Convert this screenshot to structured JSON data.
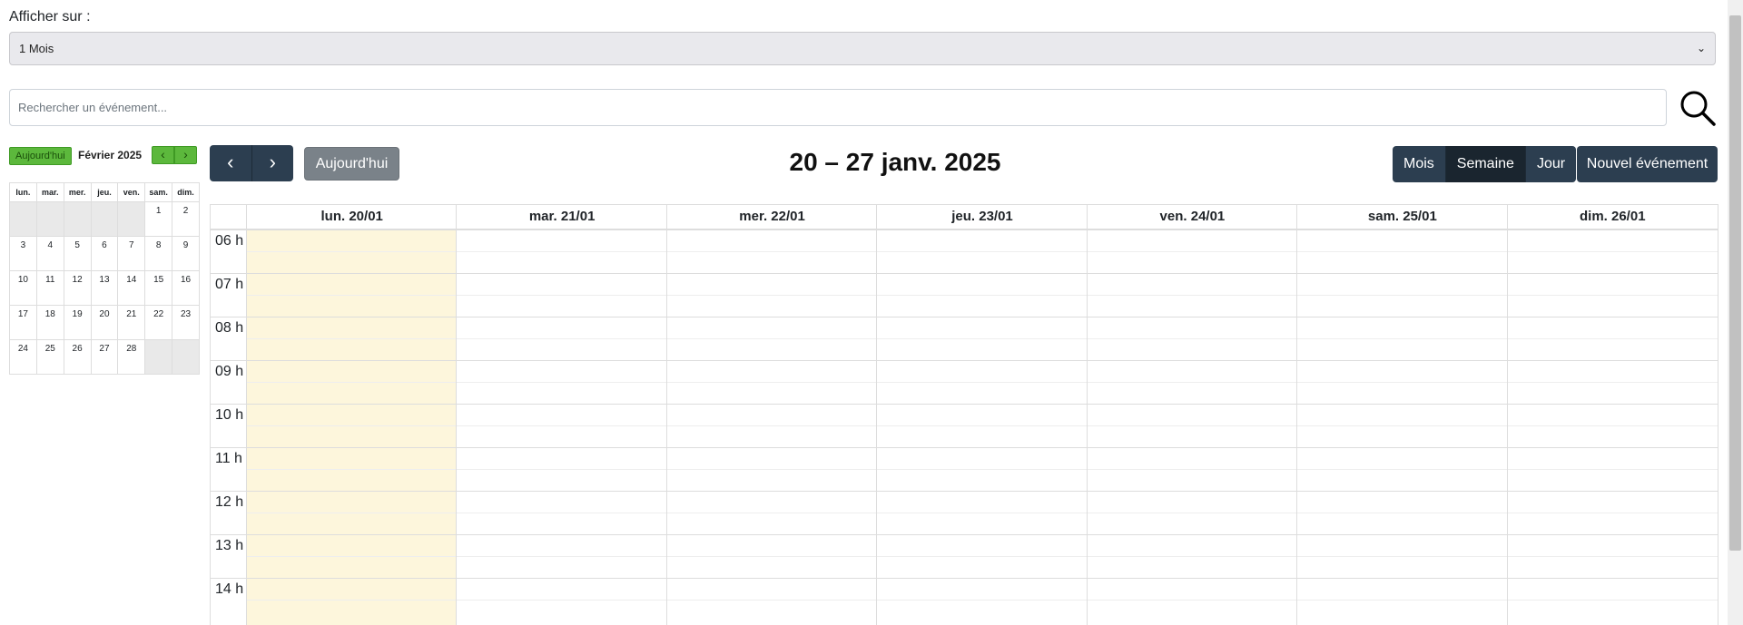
{
  "filter": {
    "label": "Afficher sur :",
    "selected": "1 Mois"
  },
  "search": {
    "placeholder": "Rechercher un événement..."
  },
  "mini_calendar": {
    "today_label": "Aujourd'hui",
    "month_title": "Février 2025",
    "weekdays": [
      "lun.",
      "mar.",
      "mer.",
      "jeu.",
      "ven.",
      "sam.",
      "dim."
    ],
    "weeks": [
      [
        "",
        "",
        "",
        "",
        "",
        "1",
        "2"
      ],
      [
        "3",
        "4",
        "5",
        "6",
        "7",
        "8",
        "9"
      ],
      [
        "10",
        "11",
        "12",
        "13",
        "14",
        "15",
        "16"
      ],
      [
        "17",
        "18",
        "19",
        "20",
        "21",
        "22",
        "23"
      ],
      [
        "24",
        "25",
        "26",
        "27",
        "28",
        "",
        ""
      ]
    ]
  },
  "toolbar": {
    "today_label": "Aujourd'hui",
    "title": "20 – 27 janv. 2025",
    "views": [
      "Mois",
      "Semaine",
      "Jour"
    ],
    "active_view": "Semaine",
    "new_event_label": "Nouvel événement"
  },
  "week": {
    "days": [
      "lun. 20/01",
      "mar. 21/01",
      "mer. 22/01",
      "jeu. 23/01",
      "ven. 24/01",
      "sam. 25/01",
      "dim. 26/01"
    ],
    "hours": [
      "06 h",
      "07 h",
      "08 h",
      "09 h",
      "10 h",
      "11 h",
      "12 h",
      "13 h",
      "14 h"
    ],
    "highlight_color": "#fdf6dc"
  },
  "colors": {
    "primary": "#2c3e50",
    "mini_green": "#5cb83c",
    "secondary": "#6c757d"
  }
}
